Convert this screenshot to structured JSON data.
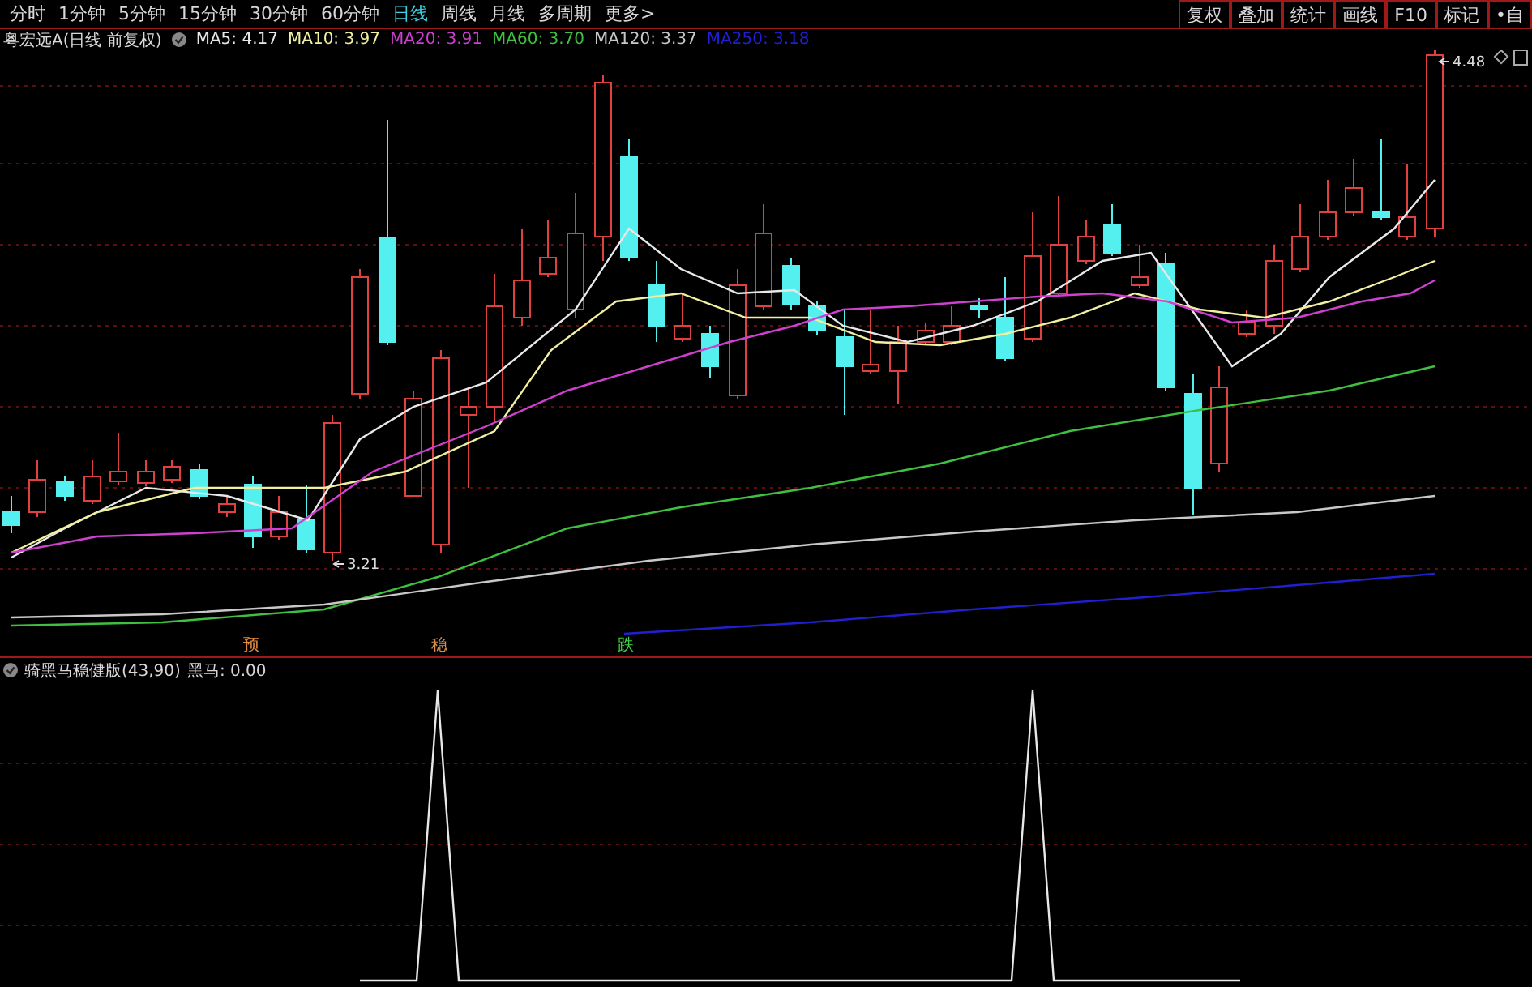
{
  "toolbar": {
    "periods": [
      {
        "label": "分时",
        "selected": false
      },
      {
        "label": "1分钟",
        "selected": false
      },
      {
        "label": "5分钟",
        "selected": false
      },
      {
        "label": "15分钟",
        "selected": false
      },
      {
        "label": "30分钟",
        "selected": false
      },
      {
        "label": "60分钟",
        "selected": false
      },
      {
        "label": "日线",
        "selected": true
      },
      {
        "label": "周线",
        "selected": false
      },
      {
        "label": "月线",
        "selected": false
      },
      {
        "label": "多周期",
        "selected": false
      },
      {
        "label": "更多>",
        "selected": false
      }
    ],
    "tools": [
      "复权",
      "叠加",
      "统计",
      "画线",
      "F10",
      "标记",
      "•自"
    ]
  },
  "legend": {
    "title": "粤宏远A(日线 前复权)",
    "averages": [
      {
        "label": "MA5: 4.17",
        "color": "#e8e8e8"
      },
      {
        "label": "MA10: 3.97",
        "color": "#f0f0a0"
      },
      {
        "label": "MA20: 3.91",
        "color": "#d040d0"
      },
      {
        "label": "MA60: 3.70",
        "color": "#40c040"
      },
      {
        "label": "MA120: 3.37",
        "color": "#c8c8c8"
      },
      {
        "label": "MA250: 3.18",
        "color": "#2020d0"
      }
    ]
  },
  "chart": {
    "high_label": "4.48",
    "low_label": "3.21",
    "signals": [
      {
        "text": "预",
        "color": "#e08a40"
      },
      {
        "text": "稳",
        "color": "#d89050"
      },
      {
        "text": "跌",
        "color": "#40d040"
      }
    ]
  },
  "indicator": {
    "name": "骑黑马稳健版(43,90)",
    "reading": "黑马: 0.00"
  }
}
